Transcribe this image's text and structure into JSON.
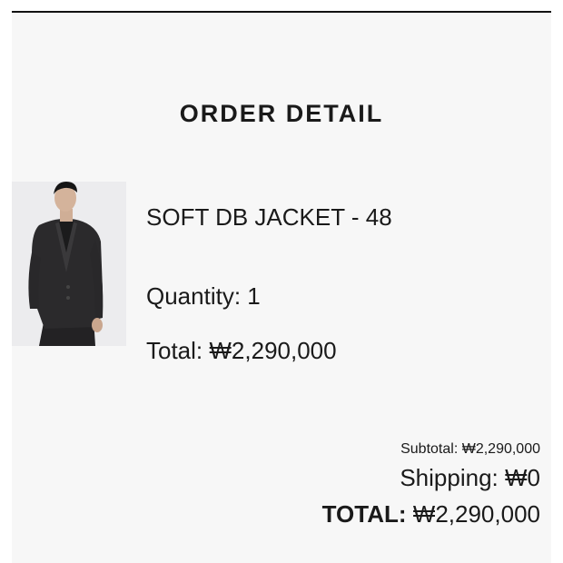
{
  "page": {
    "title": "ORDER DETAIL"
  },
  "item": {
    "name": "SOFT DB JACKET - 48",
    "quantity_label": "Quantity:",
    "quantity_value": "1",
    "total_label": "Total:",
    "total_value": "₩2,290,000",
    "image_icon": "product-photo-jacket"
  },
  "summary": {
    "subtotal_label": "Subtotal:",
    "subtotal_value": "₩2,290,000",
    "shipping_label": "Shipping:",
    "shipping_value": "₩0",
    "total_label": "TOTAL:",
    "total_value": "₩2,290,000"
  },
  "colors": {
    "panel_background": "#f7f7f7",
    "top_rule": "#111111",
    "text": "#1a1a1a",
    "jacket": "#2b2a2c"
  }
}
